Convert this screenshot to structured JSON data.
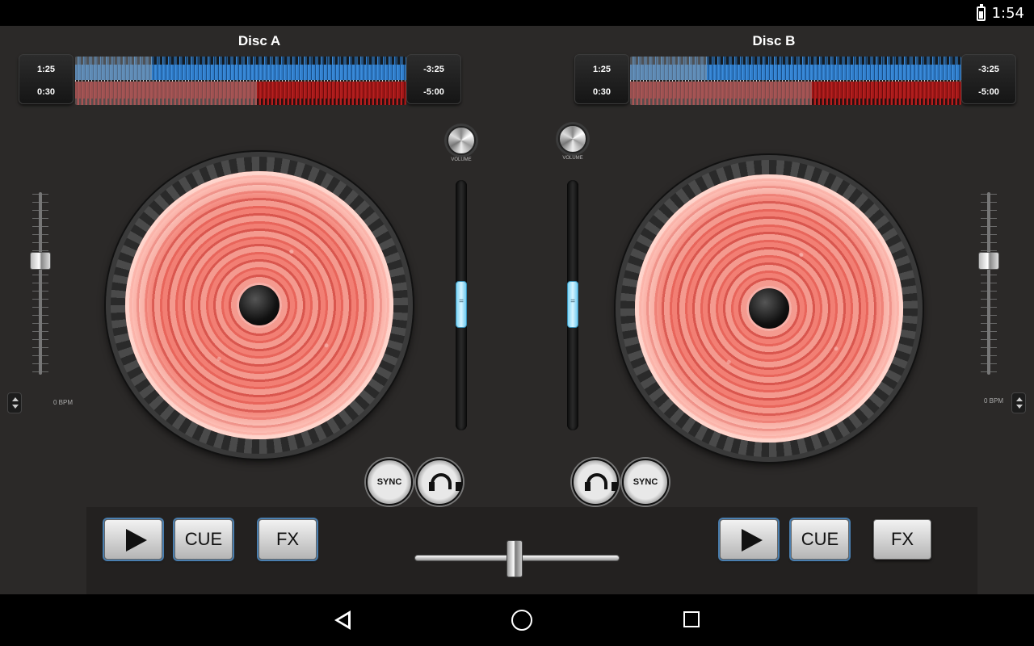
{
  "status": {
    "time": "1:54",
    "battery": "battery-icon"
  },
  "deckA": {
    "title": "Disc A",
    "elapsed_top": "1:25",
    "elapsed_bottom": "0:30",
    "remaining_top": "-3:25",
    "remaining_bottom": "-5:00",
    "bpm": "0 BPM",
    "sync_label": "SYNC",
    "cue_label": "CUE",
    "fx_label": "FX",
    "volume_label": "VOLUME"
  },
  "deckB": {
    "title": "Disc B",
    "elapsed_top": "1:25",
    "elapsed_bottom": "0:30",
    "remaining_top": "-3:25",
    "remaining_bottom": "-5:00",
    "bpm": "0 BPM",
    "sync_label": "SYNC",
    "cue_label": "CUE",
    "fx_label": "FX",
    "volume_label": "VOLUME"
  },
  "colors": {
    "background": "#2b2928",
    "panel": "#232120",
    "waveform_top": "#2f7cc9",
    "waveform_bottom": "#a21717",
    "platter": "#f08f86",
    "volume_thumb": "#7fd6f7"
  },
  "icons": [
    "play-icon",
    "headphone-icon",
    "back-icon",
    "home-icon",
    "recent-apps-icon"
  ]
}
